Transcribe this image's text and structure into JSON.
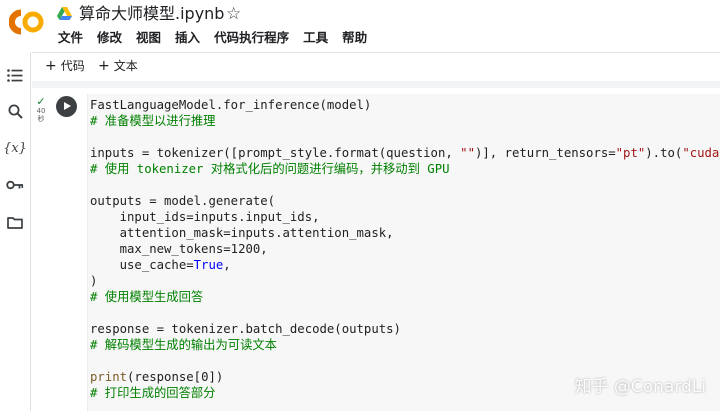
{
  "header": {
    "logo_text": "CO",
    "file_name": "算命大师模型.ipynb",
    "star_icon": "star-outline-icon"
  },
  "menu": [
    "文件",
    "修改",
    "视图",
    "插入",
    "代码执行程序",
    "工具",
    "帮助"
  ],
  "toolbar": {
    "add_code_label": "代码",
    "add_text_label": "文本"
  },
  "sidebar": {
    "items": [
      {
        "name": "table-of-contents-icon"
      },
      {
        "name": "search-icon"
      },
      {
        "name": "variables-icon",
        "glyph": "{x}"
      },
      {
        "name": "secrets-key-icon"
      },
      {
        "name": "files-folder-icon"
      }
    ]
  },
  "cell": {
    "status_icon": "✓",
    "exec_time": "40",
    "exec_unit": "秒",
    "code": {
      "l1": "FastLanguageModel.for_inference(model)",
      "l2": "# 准备模型以进行推理",
      "l3a": "inputs = tokenizer([prompt_style.format(question, ",
      "l3b": "\"\"",
      "l3c": ")], return_tensors=",
      "l3d": "\"pt\"",
      "l3e": ").to(",
      "l3f": "\"cuda\"",
      "l3g": ")",
      "l4": "# 使用 tokenizer 对格式化后的问题进行编码，并移动到 GPU",
      "l5": "outputs = model.generate(",
      "l6": "    input_ids=inputs.input_ids,",
      "l7": "    attention_mask=inputs.attention_mask,",
      "l8": "    max_new_tokens=1200,",
      "l9a": "    use_cache=",
      "l9b": "True",
      "l9c": ",",
      "l10": ")",
      "l11": "# 使用模型生成回答",
      "l12": "response = tokenizer.batch_decode(outputs)",
      "l13": "# 解码模型生成的输出为可读文本",
      "l14a": "print",
      "l14b": "(response[0])",
      "l15": "# 打印生成的回答部分"
    }
  },
  "watermark": "知乎 @ConardLi",
  "colors": {
    "string": "#a31515",
    "keyword": "#0000ff",
    "comment": "#008000",
    "builtin": "#795e26",
    "logo_orange": "#f9ab00",
    "logo_dark_orange": "#e37400"
  }
}
